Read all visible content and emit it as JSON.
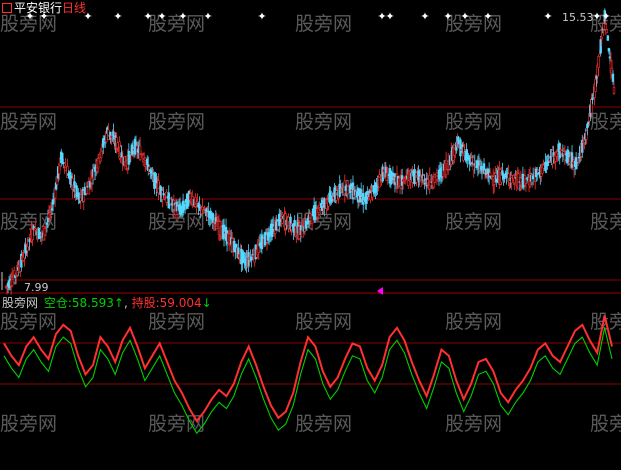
{
  "header": {
    "stock_name": "平安银行",
    "period": "日线",
    "title_icon": "red-square-icon"
  },
  "indicator": {
    "name": "股旁网",
    "short_label": "空仓:",
    "short_value": "58.593",
    "short_arrow": "↑",
    "long_label": "持股:",
    "long_value": "59.004",
    "long_arrow": "↓",
    "colors": {
      "short": "#00d000",
      "long": "#ff3030",
      "name": "#c8c8c8"
    }
  },
  "price_labels": {
    "high": "15.53",
    "low": "7.99"
  },
  "watermark": "股旁网",
  "colors": {
    "background": "#000000",
    "grid": "#8a0000",
    "separator": "#a00000",
    "candle_up": "#ff3030",
    "candle_down": "#55d8ff",
    "signal_marker": "#ffffff",
    "cursor_marker": "#ff00ff"
  },
  "icons": {
    "signal_marker": "white-cross-star-icon",
    "cursor_marker": "magenta-triangle-left-icon"
  },
  "chart_data": [
    {
      "type": "candlestick",
      "title": "平安银行 日线",
      "y_range_labels": {
        "max": 15.53,
        "min": 7.99
      },
      "close_series": [
        7.99,
        8.3,
        8.9,
        9.6,
        9.4,
        10.2,
        11.6,
        11.0,
        10.4,
        10.8,
        11.5,
        12.3,
        12.0,
        11.4,
        11.9,
        11.6,
        11.0,
        10.6,
        10.3,
        10.1,
        10.5,
        10.2,
        10.0,
        9.7,
        9.4,
        9.0,
        8.7,
        8.9,
        9.3,
        9.6,
        9.9,
        9.7,
        9.5,
        9.9,
        10.2,
        10.4,
        10.6,
        10.8,
        10.6,
        10.4,
        10.7,
        11.2,
        11.0,
        10.9,
        11.1,
        11.0,
        10.9,
        11.1,
        11.4,
        12.0,
        11.6,
        11.4,
        11.2,
        11.0,
        11.1,
        11.0,
        10.9,
        11.0,
        11.2,
        11.5,
        11.8,
        11.6,
        11.4,
        12.3,
        13.6,
        15.53,
        13.5
      ]
    },
    {
      "type": "line",
      "series": [
        {
          "name": "空仓",
          "last": 58.593
        },
        {
          "name": "持股",
          "last": 59.004
        }
      ],
      "values": [
        72,
        64,
        58,
        70,
        76,
        68,
        62,
        78,
        84,
        80,
        64,
        52,
        58,
        76,
        70,
        60,
        74,
        82,
        70,
        56,
        64,
        72,
        60,
        48,
        40,
        30,
        22,
        28,
        36,
        42,
        38,
        46,
        60,
        70,
        58,
        44,
        32,
        24,
        28,
        40,
        60,
        76,
        70,
        54,
        44,
        50,
        62,
        72,
        70,
        56,
        48,
        58,
        76,
        82,
        74,
        60,
        48,
        38,
        52,
        68,
        64,
        48,
        36,
        46,
        60,
        62,
        54,
        40,
        34,
        42,
        48,
        56,
        68,
        72,
        64,
        60,
        70,
        80,
        84,
        74,
        66,
        90,
        70
      ]
    }
  ]
}
